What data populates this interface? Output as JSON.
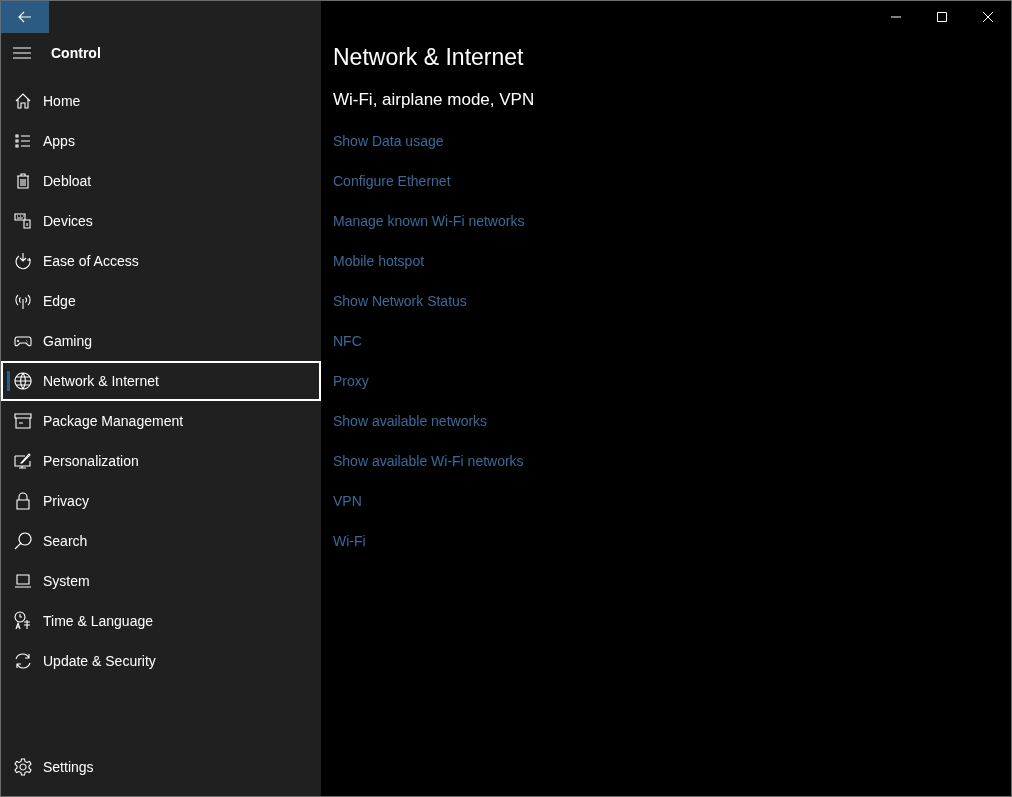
{
  "sidebar": {
    "title": "Control",
    "items": [
      {
        "label": "Home",
        "selected": false
      },
      {
        "label": "Apps",
        "selected": false
      },
      {
        "label": "Debloat",
        "selected": false
      },
      {
        "label": "Devices",
        "selected": false
      },
      {
        "label": "Ease of Access",
        "selected": false
      },
      {
        "label": "Edge",
        "selected": false
      },
      {
        "label": "Gaming",
        "selected": false
      },
      {
        "label": "Network & Internet",
        "selected": true
      },
      {
        "label": "Package Management",
        "selected": false
      },
      {
        "label": "Personalization",
        "selected": false
      },
      {
        "label": "Privacy",
        "selected": false
      },
      {
        "label": "Search",
        "selected": false
      },
      {
        "label": "System",
        "selected": false
      },
      {
        "label": "Time & Language",
        "selected": false
      },
      {
        "label": "Update & Security",
        "selected": false
      }
    ],
    "footer": "Settings"
  },
  "page": {
    "title": "Network & Internet",
    "subtitle": "Wi-Fi, airplane mode, VPN",
    "links": [
      "Show Data usage",
      "Configure Ethernet",
      "Manage known Wi-Fi networks",
      "Mobile hotspot",
      "Show Network Status",
      "NFC",
      "Proxy",
      "Show available networks",
      "Show available Wi-Fi networks",
      "VPN",
      "Wi-Fi"
    ]
  }
}
